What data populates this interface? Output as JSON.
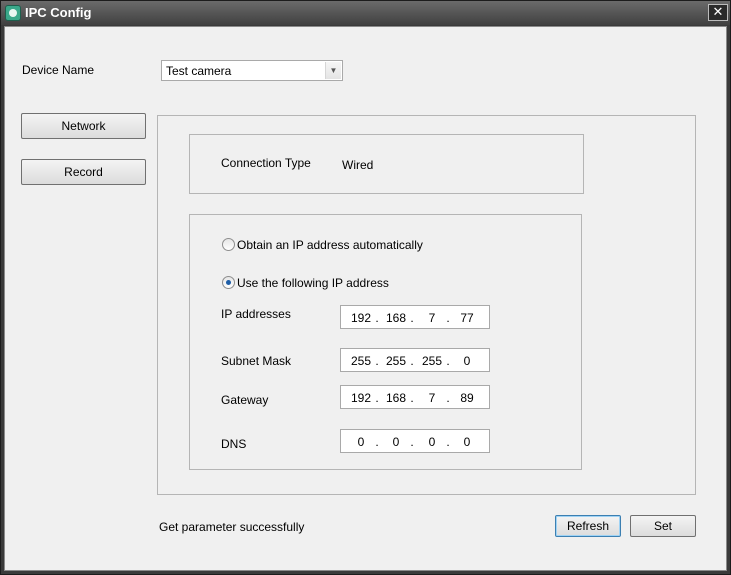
{
  "window": {
    "title": "IPC Config",
    "close_glyph": "✕",
    "icon": "camera-app-icon",
    "close_icon": "close-icon"
  },
  "device": {
    "label": "Device Name",
    "value": "Test camera"
  },
  "nav": {
    "network_label": "Network",
    "record_label": "Record"
  },
  "connection": {
    "label": "Connection Type",
    "value": "Wired"
  },
  "ip_mode": {
    "auto_label": "Obtain an IP address automatically",
    "manual_label": "Use the following IP address",
    "selected": "manual"
  },
  "fields": [
    {
      "label": "IP addresses",
      "octets": [
        "192",
        "168",
        "7",
        "77"
      ]
    },
    {
      "label": "Subnet Mask",
      "octets": [
        "255",
        "255",
        "255",
        "0"
      ]
    },
    {
      "label": "Gateway",
      "octets": [
        "192",
        "168",
        "7",
        "89"
      ]
    },
    {
      "label": "DNS",
      "octets": [
        "0",
        "0",
        "0",
        "0"
      ]
    }
  ],
  "status": {
    "text": "Get parameter successfully"
  },
  "actions": {
    "refresh_label": "Refresh",
    "set_label": "Set"
  },
  "colors": {
    "titlebar": "#404040",
    "client_bg": "#f0f0f0",
    "radio_dot": "#1e5ea7",
    "default_button_border": "#3c7fb1"
  }
}
